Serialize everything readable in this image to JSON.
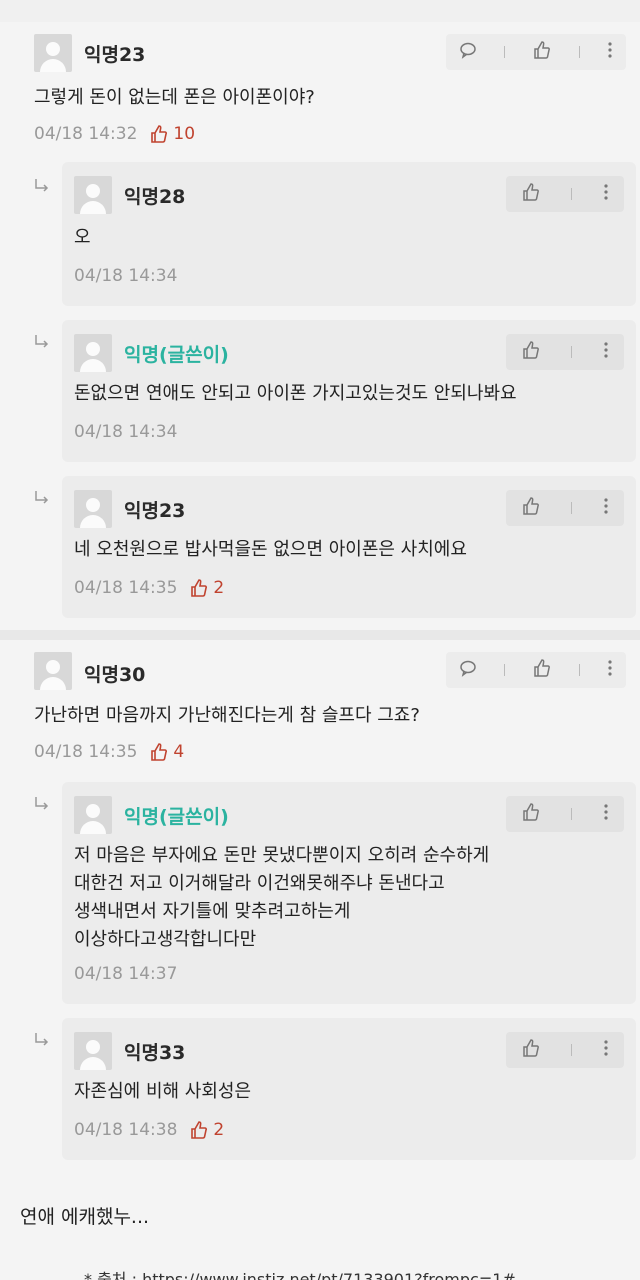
{
  "comments": [
    {
      "name": "익명23",
      "text": "그렇게 돈이 없는데 폰은 아이폰이야?",
      "time": "04/18 14:32",
      "likes": "10"
    },
    {
      "name": "익명28",
      "text": "오",
      "time": "04/18 14:34"
    },
    {
      "name": "익명(글쓴이)",
      "text": "돈없으면 연애도 안되고 아이폰 가지고있는것도 안되나봐요",
      "time": "04/18 14:34"
    },
    {
      "name": "익명23",
      "text": "네 오천원으로 밥사먹을돈 없으면 아이폰은 사치에요",
      "time": "04/18 14:35",
      "likes": "2"
    },
    {
      "name": "익명30",
      "text": "가난하면 마음까지 가난해진다는게 참 슬프다 그죠?",
      "time": "04/18 14:35",
      "likes": "4"
    },
    {
      "name": "익명(글쓴이)",
      "lines": [
        "저 마음은 부자에요 돈만 못냈다뿐이지 오히려 순수하게",
        "대한건 저고 이거해달라 이건왜못해주냐 돈낸다고",
        "생색내면서 자기틀에 맞추려고하는게",
        "이상하다고생각합니다만"
      ],
      "time": "04/18 14:37"
    },
    {
      "name": "익명33",
      "text": "자존심에 비해 사회성은",
      "time": "04/18 14:38",
      "likes": "2"
    }
  ],
  "post_text": "연애 에캐했누...",
  "source": "* 출처 : https://www.instiz.net/pt/7133901?frompc=1#",
  "colors": {
    "op_name": "#2bb3a0",
    "like": "#c0432f"
  }
}
